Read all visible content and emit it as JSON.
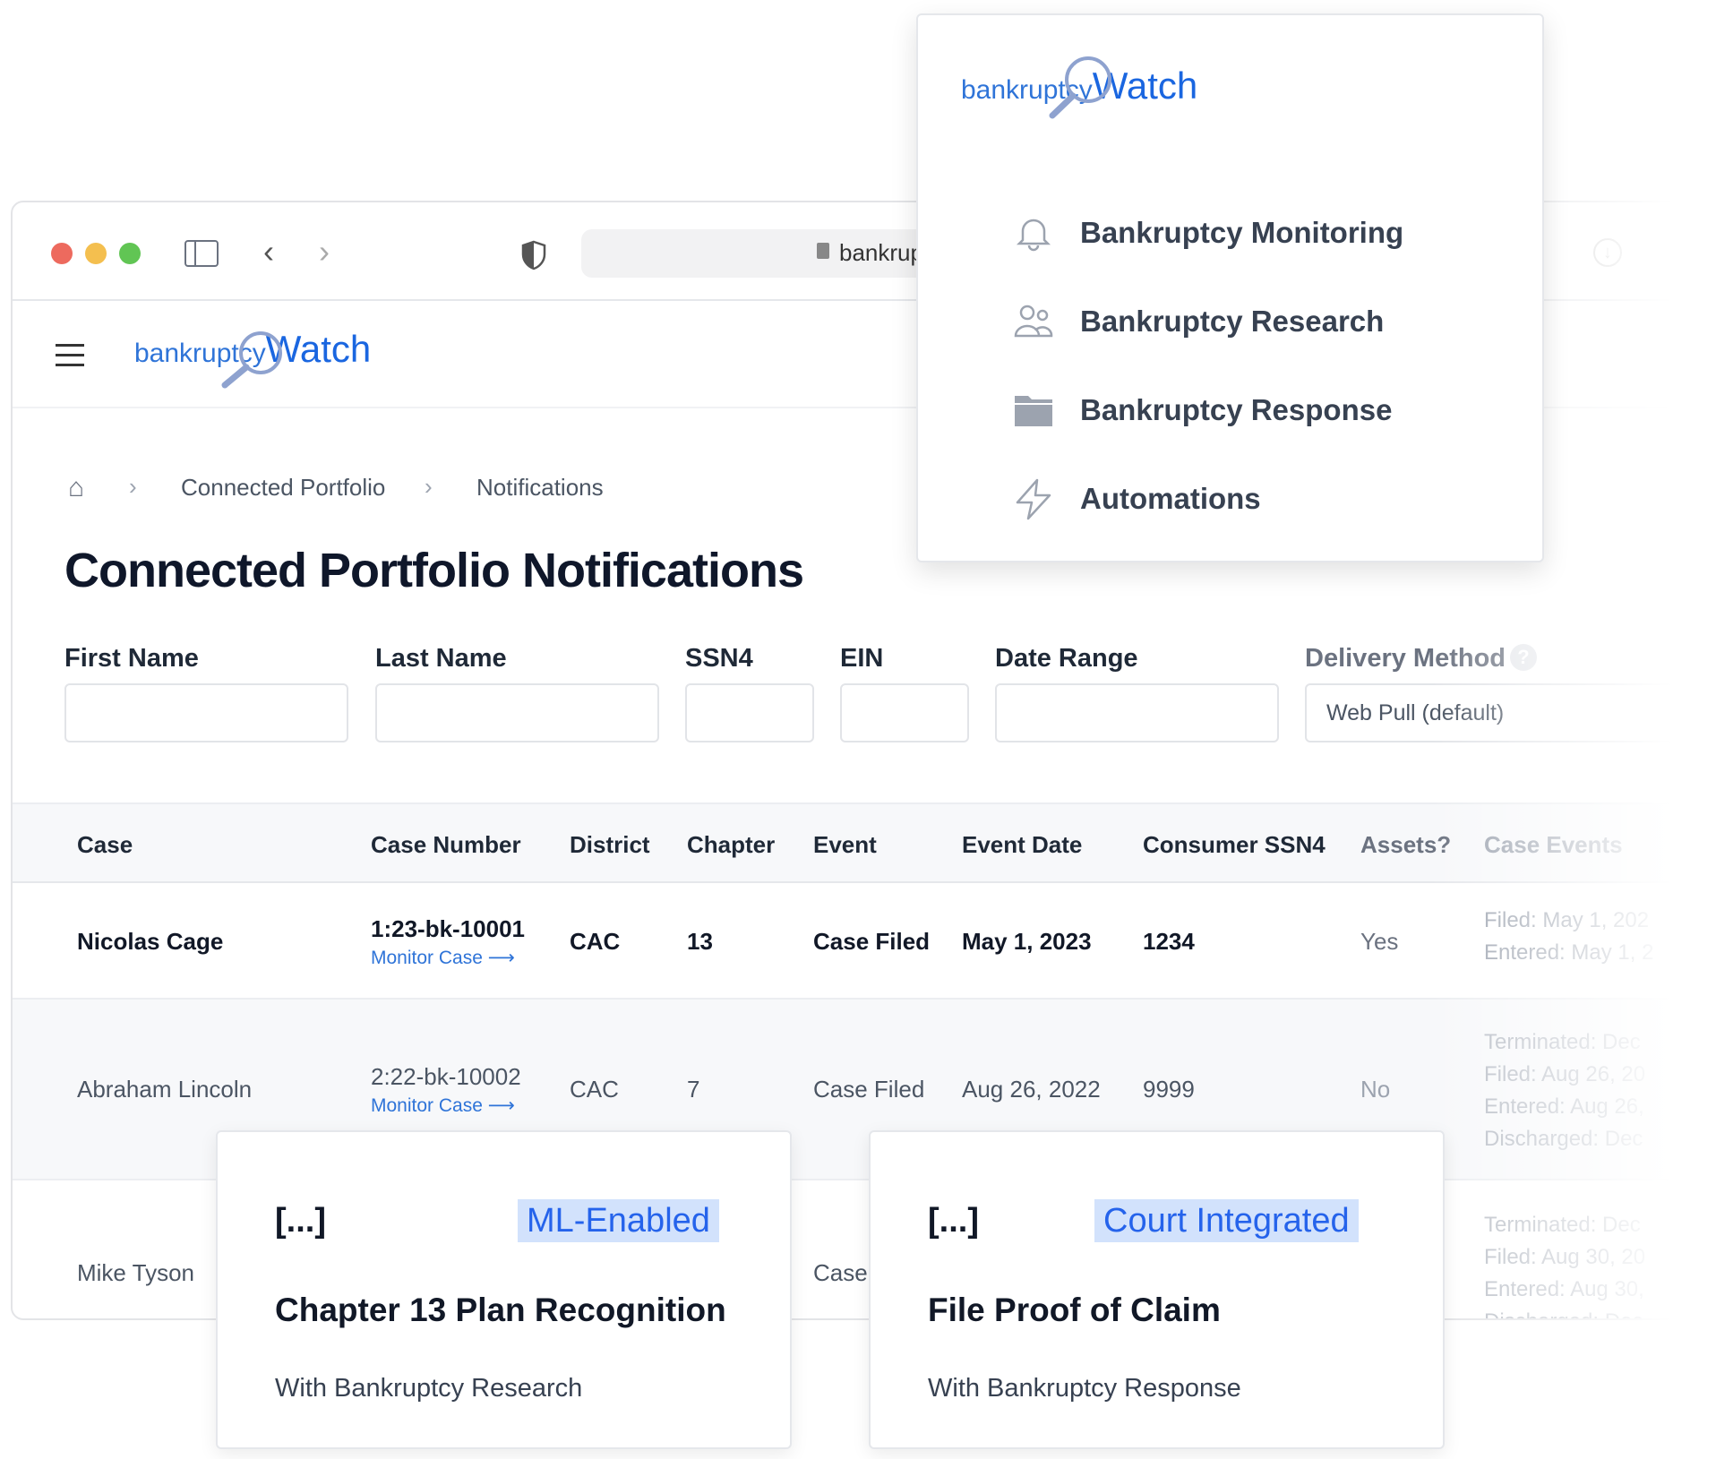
{
  "browser": {
    "url": "bankruptcywatch.com"
  },
  "logo": {
    "part1": "bankruptcy",
    "part2": "Watch"
  },
  "breadcrumb": [
    "Connected Portfolio",
    "Notifications"
  ],
  "page_title": "Connected Portfolio Notifications",
  "filters": {
    "first_name": "First Name",
    "last_name": "Last Name",
    "ssn4": "SSN4",
    "ein": "EIN",
    "date_range": "Date Range",
    "delivery_method": "Delivery Method",
    "delivery_value": "Web Pull (default)"
  },
  "table": {
    "headers": [
      "Case",
      "Case Number",
      "District",
      "Chapter",
      "Event",
      "Event Date",
      "Consumer SSN4",
      "Assets?",
      "Case Events"
    ],
    "monitor_label": "Monitor Case",
    "rows": [
      {
        "case": "Nicolas Cage",
        "number": "1:23-bk-10001",
        "district": "CAC",
        "chapter": "13",
        "event": "Case Filed",
        "date": "May 1, 2023",
        "ssn4": "1234",
        "assets": "Yes",
        "events": [
          "Filed: May 1, 202",
          "Entered: May 1, 2"
        ]
      },
      {
        "case": "Abraham Lincoln",
        "number": "2:22-bk-10002",
        "district": "CAC",
        "chapter": "7",
        "event": "Case Filed",
        "date": "Aug 26, 2022",
        "ssn4": "9999",
        "assets": "No",
        "events": [
          "Terminated: Dec",
          "Filed: Aug 26, 20",
          "Entered: Aug 26,",
          "Discharged: Dec"
        ]
      },
      {
        "case": "Mike Tyson",
        "event": "Case",
        "events": [
          "Terminated: Dec",
          "Filed: Aug 30, 20",
          "Entered: Aug 30,",
          "Discharged: Dec"
        ]
      }
    ]
  },
  "menu": {
    "items": [
      {
        "label": "Bankruptcy Monitoring",
        "icon": "bell-icon"
      },
      {
        "label": "Bankruptcy Research",
        "icon": "users-icon"
      },
      {
        "label": "Bankruptcy Response",
        "icon": "folder-icon"
      },
      {
        "label": "Automations",
        "icon": "lightning-icon"
      }
    ]
  },
  "cards": [
    {
      "ellipsis": "[...]",
      "badge": "ML-Enabled",
      "title": "Chapter 13 Plan Recognition",
      "subtitle": "With Bankruptcy Research"
    },
    {
      "ellipsis": "[...]",
      "badge": "Court Integrated",
      "title": "File Proof of Claim",
      "subtitle": "With Bankruptcy Response"
    }
  ],
  "colors": {
    "accent": "#2f74d8",
    "badge_bg": "#d2e2fc"
  }
}
